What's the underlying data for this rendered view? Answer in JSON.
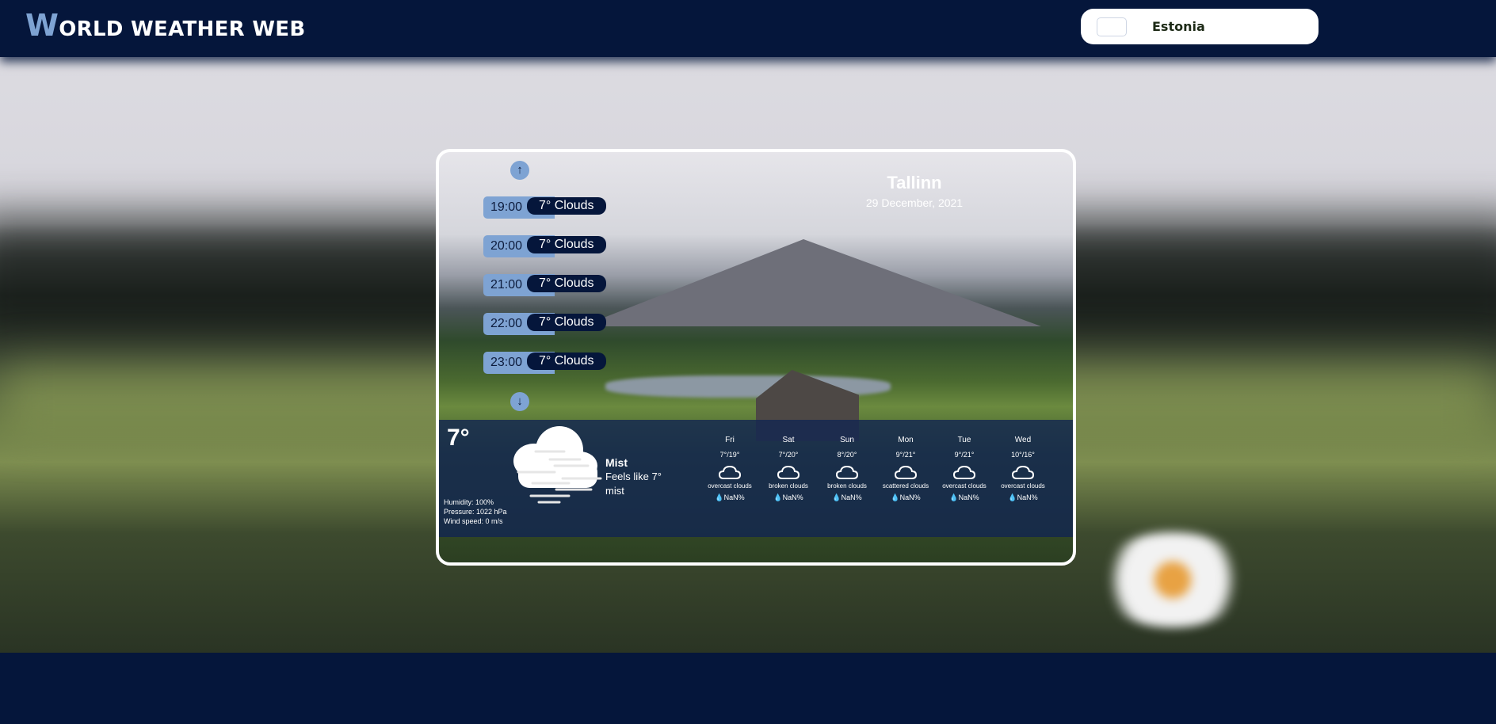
{
  "header": {
    "logo_initial": "W",
    "logo_rest": "ORLD WEATHER WEB"
  },
  "search": {
    "value": "Estonia",
    "icon": "search-icon"
  },
  "location": {
    "city": "Tallinn",
    "date": "29 December, 2021"
  },
  "hourly": [
    {
      "time": "19:00",
      "desc": "7° Clouds"
    },
    {
      "time": "20:00",
      "desc": "7° Clouds"
    },
    {
      "time": "21:00",
      "desc": "7° Clouds"
    },
    {
      "time": "22:00",
      "desc": "7° Clouds"
    },
    {
      "time": "23:00",
      "desc": "7° Clouds"
    }
  ],
  "current": {
    "temperature": "7°",
    "condition": "Mist",
    "feels_like": "Feels like 7°",
    "description": "mist",
    "humidity": "Humidity: 100%",
    "pressure": "Pressure: 1022 hPa",
    "wind": "Wind speed: 0 m/s",
    "icon": "mist-cloud-icon"
  },
  "forecast": [
    {
      "day": "Fri",
      "minmax": "7°/19°",
      "desc": "overcast clouds",
      "humidity": "NaN%"
    },
    {
      "day": "Sat",
      "minmax": "7°/20°",
      "desc": "broken clouds",
      "humidity": "NaN%"
    },
    {
      "day": "Sun",
      "minmax": "8°/20°",
      "desc": "broken clouds",
      "humidity": "NaN%"
    },
    {
      "day": "Mon",
      "minmax": "9°/21°",
      "desc": "scattered clouds",
      "humidity": "NaN%"
    },
    {
      "day": "Tue",
      "minmax": "9°/21°",
      "desc": "overcast clouds",
      "humidity": "NaN%"
    },
    {
      "day": "Wed",
      "minmax": "10°/16°",
      "desc": "overcast clouds",
      "humidity": "NaN%"
    }
  ],
  "colors": {
    "navy": "#05163b",
    "accent": "#7ea3d3",
    "white": "#ffffff"
  }
}
